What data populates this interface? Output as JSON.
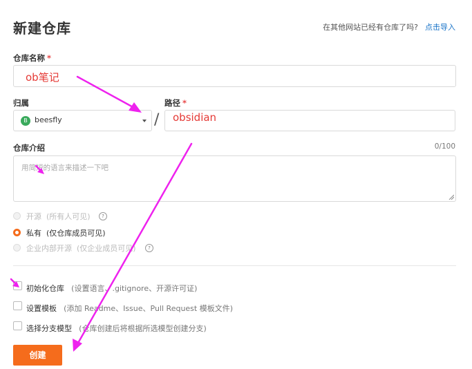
{
  "header": {
    "title": "新建仓库",
    "import_question": "在其他网站已经有仓库了吗?",
    "import_link": "点击导入"
  },
  "repo_name": {
    "label": "仓库名称",
    "required_mark": "*",
    "value": "ob笔记"
  },
  "owner": {
    "label": "归属",
    "avatar_letter": "B",
    "value": "beesfly"
  },
  "separator": "/",
  "path": {
    "label": "路径",
    "required_mark": "*",
    "value": "obsidian"
  },
  "description": {
    "label": "仓库介绍",
    "placeholder": "用简短的语言来描述一下吧",
    "counter": "0/100"
  },
  "visibility": {
    "options": [
      {
        "label": "开源",
        "hint": "(所有人可见)",
        "state": "disabled",
        "help": "?"
      },
      {
        "label": "私有",
        "hint": "(仅仓库成员可见)",
        "state": "selected",
        "help": ""
      },
      {
        "label": "企业内部开源",
        "hint": "(仅企业成员可见)",
        "state": "disabled",
        "help": "?"
      }
    ]
  },
  "init_options": [
    {
      "label": "初始化仓库",
      "hint": "(设置语言、.gitignore、开源许可证)"
    },
    {
      "label": "设置模板",
      "hint": "(添加 Readme、Issue、Pull Request 模板文件)"
    },
    {
      "label": "选择分支模型",
      "hint": "(仓库创建后将根据所选模型创建分支)"
    }
  ],
  "create_button": "创建",
  "colors": {
    "accent": "#f56c1c",
    "annotation_arrow": "#ee22ee",
    "link": "#1a74c8",
    "typed_text": "#e53935"
  }
}
